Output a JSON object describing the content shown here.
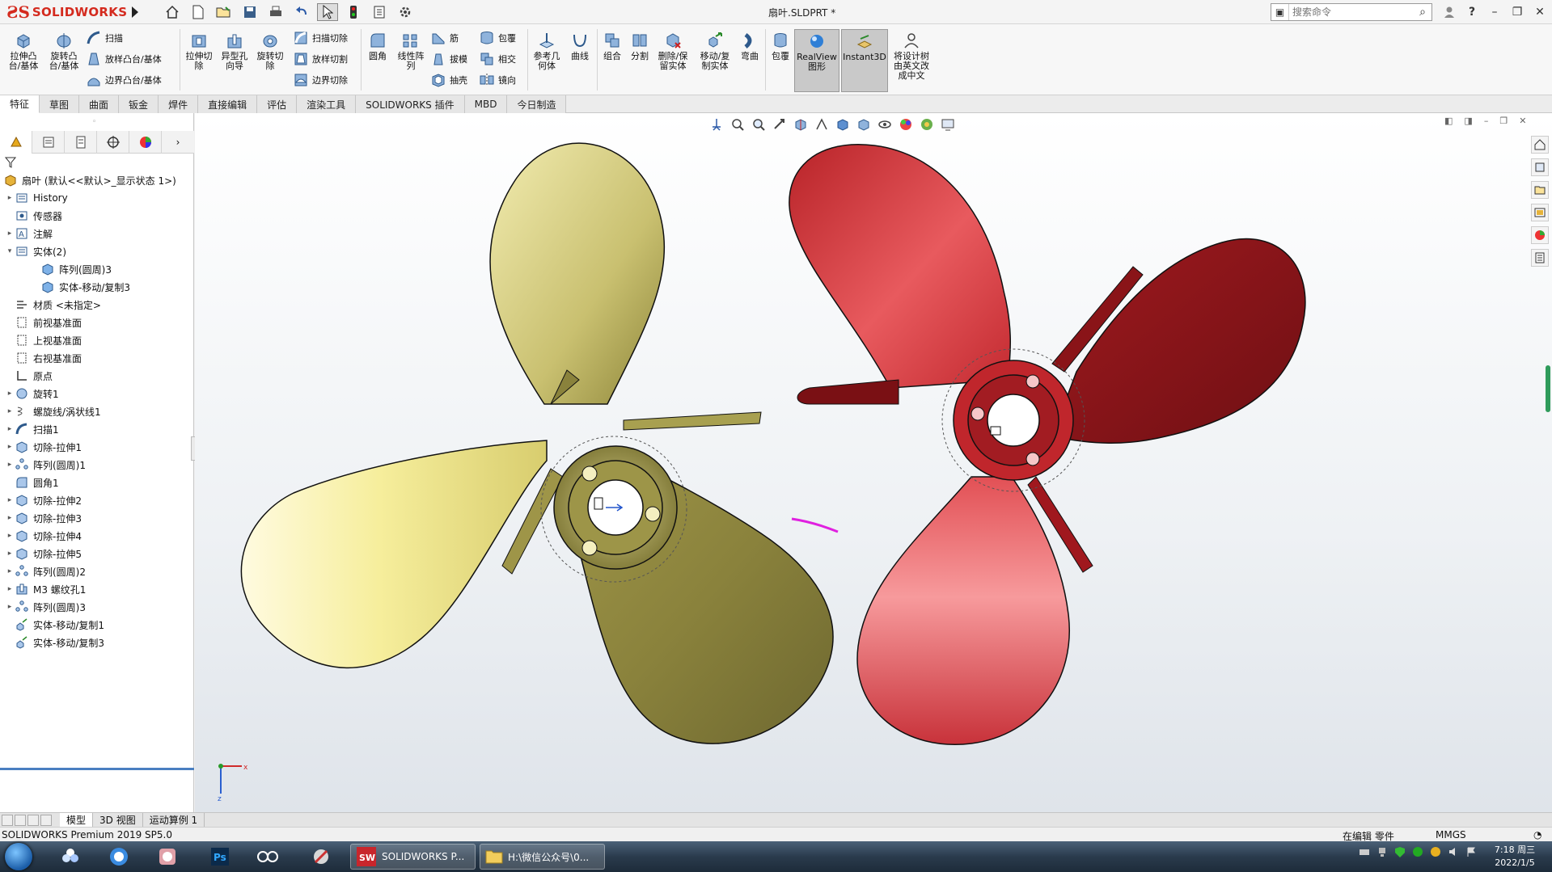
{
  "window": {
    "brand": "SOLIDWORKS",
    "doc_title": "扇叶.SLDPRT *",
    "search_placeholder": "搜索命令"
  },
  "ribbon": {
    "extrude_boss": "拉伸凸台/基体",
    "revolve_boss": "旋转凸台/基体",
    "sweep": "扫描",
    "loft_boss": "放样凸台/基体",
    "boundary_boss": "边界凸台/基体",
    "extrude_cut": "拉伸切除",
    "hole_wizard": "异型孔向导",
    "revolve_cut": "旋转切除",
    "sweep_cut": "扫描切除",
    "loft_cut": "放样切割",
    "boundary_cut": "边界切除",
    "fillet": "圆角",
    "linear_pattern": "线性阵列",
    "rib": "筋",
    "draft": "拔模",
    "shell": "抽壳",
    "wrap": "包覆",
    "intersect": "相交",
    "mirror": "镜向",
    "ref_geometry": "参考几何体",
    "curves": "曲线",
    "combine": "组合",
    "split": "分割",
    "delete_keep_body": "删除/保留实体",
    "move_copy_body": "移动/复制实体",
    "flex": "弯曲",
    "wrap2": "包覆",
    "realview": "RealView图形",
    "instant3d": "Instant3D",
    "translate_tree": "将设计树由英文改成中文"
  },
  "cm_tabs": [
    "特征",
    "草图",
    "曲面",
    "钣金",
    "焊件",
    "直接编辑",
    "评估",
    "渲染工具",
    "SOLIDWORKS 插件",
    "MBD",
    "今日制造"
  ],
  "tree": {
    "root": "扇叶 (默认<<默认>_显示状态 1>)",
    "items": [
      {
        "label": "History",
        "exp": "▸",
        "indent": 0
      },
      {
        "label": "传感器",
        "exp": "",
        "indent": 0
      },
      {
        "label": "注解",
        "exp": "▸",
        "indent": 0
      },
      {
        "label": "实体(2)",
        "exp": "▾",
        "indent": 0
      },
      {
        "label": "阵列(圆周)3",
        "exp": "",
        "indent": 1
      },
      {
        "label": "实体-移动/复制3",
        "exp": "",
        "indent": 1
      },
      {
        "label": "材质 <未指定>",
        "exp": "",
        "indent": 0
      },
      {
        "label": "前视基准面",
        "exp": "",
        "indent": 0
      },
      {
        "label": "上视基准面",
        "exp": "",
        "indent": 0
      },
      {
        "label": "右视基准面",
        "exp": "",
        "indent": 0
      },
      {
        "label": "原点",
        "exp": "",
        "indent": 0
      },
      {
        "label": "旋转1",
        "exp": "▸",
        "indent": 0
      },
      {
        "label": "螺旋线/涡状线1",
        "exp": "▸",
        "indent": 0
      },
      {
        "label": "扫描1",
        "exp": "▸",
        "indent": 0
      },
      {
        "label": "切除-拉伸1",
        "exp": "▸",
        "indent": 0
      },
      {
        "label": "阵列(圆周)1",
        "exp": "▸",
        "indent": 0
      },
      {
        "label": "圆角1",
        "exp": "",
        "indent": 0
      },
      {
        "label": "切除-拉伸2",
        "exp": "▸",
        "indent": 0
      },
      {
        "label": "切除-拉伸3",
        "exp": "▸",
        "indent": 0
      },
      {
        "label": "切除-拉伸4",
        "exp": "▸",
        "indent": 0
      },
      {
        "label": "切除-拉伸5",
        "exp": "▸",
        "indent": 0
      },
      {
        "label": "阵列(圆周)2",
        "exp": "▸",
        "indent": 0
      },
      {
        "label": "M3 螺纹孔1",
        "exp": "▸",
        "indent": 0
      },
      {
        "label": "阵列(圆周)3",
        "exp": "▸",
        "indent": 0
      },
      {
        "label": "实体-移动/复制1",
        "exp": "",
        "indent": 0
      },
      {
        "label": "实体-移动/复制3",
        "exp": "",
        "indent": 0
      }
    ]
  },
  "bottom_tabs": [
    "模型",
    "3D 视图",
    "运动算例 1"
  ],
  "status": {
    "product": "SOLIDWORKS Premium 2019 SP5.0",
    "editing": "在编辑 零件",
    "units": "MMGS"
  },
  "taskbar": {
    "sw_task": "SOLIDWORKS P...",
    "folder_task": "H:\\微信公众号\\0...",
    "time": "7:18 周三",
    "date": "2022/1/5"
  },
  "colors": {
    "brand_red": "#d42a1e",
    "yellow_prop": "#d8d07a",
    "red_prop": "#c8282e"
  },
  "triad": {
    "x": "x",
    "z": "z"
  }
}
